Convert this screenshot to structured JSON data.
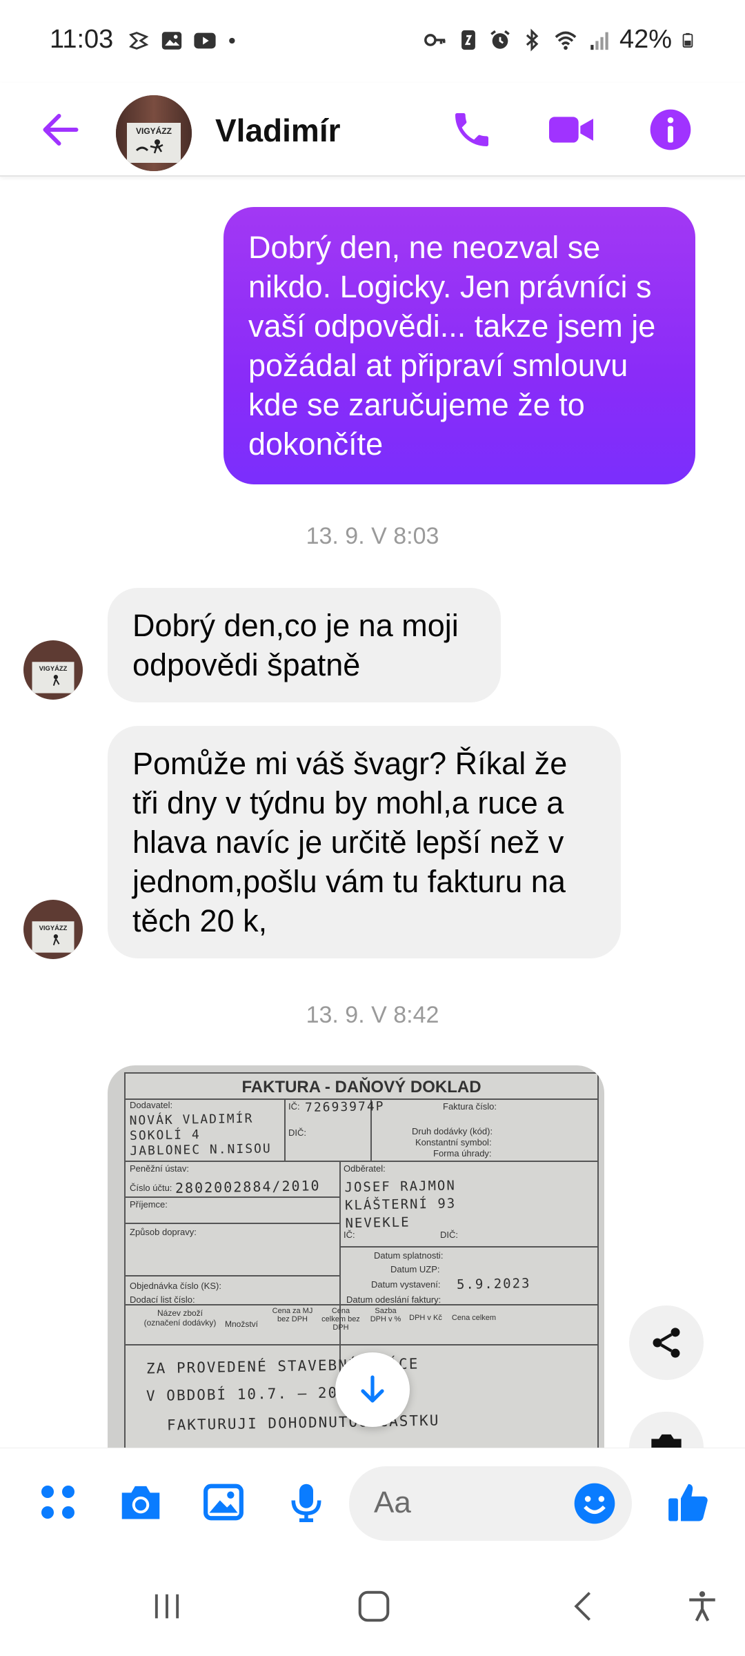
{
  "status_bar": {
    "time": "11:03",
    "battery": "42%"
  },
  "header": {
    "contact_name": "Vladimír",
    "avatar_text": "VIGYÁZZ"
  },
  "messages": {
    "outgoing_1": "Dobrý den,  ne neozval se nikdo. Logicky. Jen právníci s vaší odpovědi... takze jsem je požádal at připraví smlouvu kde se zaručujeme že to dokončíte",
    "timestamp_1": "13. 9. V 8:03",
    "incoming_1": "Dobrý den,co je na moji odpovědi špatně",
    "incoming_2": "Pomůže mi váš švagr? Říkal že tři dny v týdnu by mohl,a ruce a hlava navíc je určitě lepší než v jednom,pošlu vám tu fakturu na těch 20 k,",
    "timestamp_2": "13. 9. V 8:42"
  },
  "invoice": {
    "title": "FAKTURA - DAŇOVÝ DOKLAD",
    "labels": {
      "dodavatel": "Dodavatel:",
      "ic": "IČ:",
      "dic": "DIČ:",
      "faktura_cislo": "Faktura číslo:",
      "druh_dodavky": "Druh dodávky (kód):",
      "konst_symbol": "Konstantní symbol:",
      "forma_uhrady": "Forma úhrady:",
      "penezni_ustav": "Peněžní ústav:",
      "cislo_uctu": "Číslo účtu:",
      "prijemce": "Příjemce:",
      "zpusob_dopravy": "Způsob dopravy:",
      "odberatel": "Odběratel:",
      "ic2": "IČ:",
      "dic2": "DIČ:",
      "datum_splatnosti": "Datum splatnosti:",
      "datum_uzp": "Datum UZP:",
      "datum_vystaveni": "Datum vystavení:",
      "objednavka": "Objednávka číslo (KS):",
      "dodaci_list": "Dodací list číslo:",
      "datum_odeslani": "Datum odeslání faktury:",
      "col_nazev": "Název zboží (označení dodávky)",
      "col_mnozstvi": "Množství",
      "col_cena_mj": "Cena za MJ bez DPH",
      "col_cena_celkem": "Cena celkem bez DPH",
      "col_sazba": "Sazba DPH v %",
      "col_dph": "DPH v Kč",
      "col_cena": "Cena celkem"
    },
    "handwriting": {
      "supplier": "NOVÁK VLADIMÍR SOKOLÍ 4 JABLONEC N.NISOU",
      "ic_value": "72693974P",
      "account": "2802002884/2010",
      "customer": "JOSEF RAJMON KLÁŠTERNÍ 93 NEVEKLE",
      "date_issued": "5.9.2023",
      "line1": "ZA PROVEDENÉ STAVEBNÍ PRÁCE",
      "line2": "V OBDOBÍ 10.7. — 2023 VÁM",
      "line3": "FAKTURUJI DOHODNUTOU ČÁSTKU"
    }
  },
  "composer": {
    "placeholder": "Aa"
  },
  "colors": {
    "accent": "#a033ff",
    "blue": "#0a7cff",
    "bubble_in": "#f0f0f0"
  }
}
